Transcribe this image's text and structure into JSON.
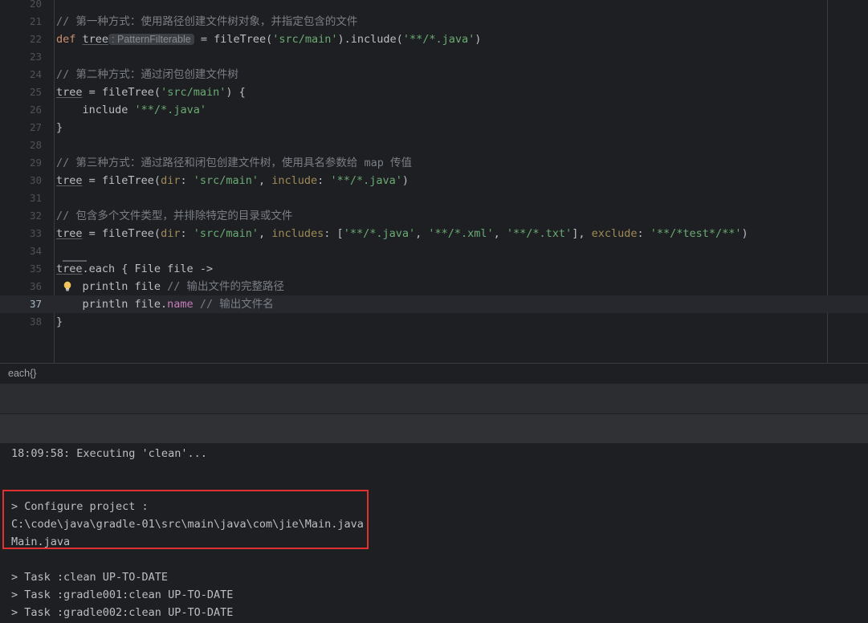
{
  "editor": {
    "name": "code-editor",
    "language": "Groovy",
    "margin_guide_column": 1030,
    "current_line": 37,
    "lines": [
      {
        "no": "20",
        "segments": []
      },
      {
        "no": "21",
        "segments": [
          {
            "t": "cmt",
            "s": "// 第一种方式：使用路径创建文件树对象，并指定包含的文件"
          }
        ]
      },
      {
        "no": "22",
        "segments": [
          {
            "t": "kw",
            "s": "def "
          },
          {
            "t": "ident-u",
            "s": "tree"
          },
          {
            "t": "hint",
            "s": ": PatternFilterable"
          },
          {
            "t": "plain",
            "s": " = fileTree("
          },
          {
            "t": "str",
            "s": "'src/main'"
          },
          {
            "t": "plain",
            "s": ").include("
          },
          {
            "t": "str",
            "s": "'**/*.java'"
          },
          {
            "t": "plain",
            "s": ")"
          }
        ]
      },
      {
        "no": "23",
        "segments": []
      },
      {
        "no": "24",
        "segments": [
          {
            "t": "cmt",
            "s": "// 第二种方式：通过闭包创建文件树"
          }
        ]
      },
      {
        "no": "25",
        "segments": [
          {
            "t": "ident-u",
            "s": "tree"
          },
          {
            "t": "plain",
            "s": " = fileTree("
          },
          {
            "t": "str",
            "s": "'src/main'"
          },
          {
            "t": "plain",
            "s": ") {"
          }
        ]
      },
      {
        "no": "26",
        "segments": [
          {
            "t": "plain",
            "s": "    include "
          },
          {
            "t": "str",
            "s": "'**/*.java'"
          }
        ]
      },
      {
        "no": "27",
        "segments": [
          {
            "t": "plain",
            "s": "}"
          }
        ]
      },
      {
        "no": "28",
        "segments": []
      },
      {
        "no": "29",
        "segments": [
          {
            "t": "cmt",
            "s": "// 第三种方式：通过路径和闭包创建文件树，使用具名参数给 map 传值"
          }
        ]
      },
      {
        "no": "30",
        "segments": [
          {
            "t": "ident-u",
            "s": "tree"
          },
          {
            "t": "plain",
            "s": " = fileTree("
          },
          {
            "t": "narg",
            "s": "dir"
          },
          {
            "t": "plain",
            "s": ": "
          },
          {
            "t": "str",
            "s": "'src/main'"
          },
          {
            "t": "plain",
            "s": ", "
          },
          {
            "t": "narg",
            "s": "include"
          },
          {
            "t": "plain",
            "s": ": "
          },
          {
            "t": "str",
            "s": "'**/*.java'"
          },
          {
            "t": "plain",
            "s": ")"
          }
        ]
      },
      {
        "no": "31",
        "segments": []
      },
      {
        "no": "32",
        "segments": [
          {
            "t": "cmt",
            "s": "// 包含多个文件类型，并排除特定的目录或文件"
          }
        ]
      },
      {
        "no": "33",
        "segments": [
          {
            "t": "ident-u",
            "s": "tree"
          },
          {
            "t": "plain",
            "s": " = fileTree("
          },
          {
            "t": "narg",
            "s": "dir"
          },
          {
            "t": "plain",
            "s": ": "
          },
          {
            "t": "str",
            "s": "'src/main'"
          },
          {
            "t": "plain",
            "s": ", "
          },
          {
            "t": "narg",
            "s": "includes"
          },
          {
            "t": "plain",
            "s": ": ["
          },
          {
            "t": "str",
            "s": "'**/*.java'"
          },
          {
            "t": "plain",
            "s": ", "
          },
          {
            "t": "str",
            "s": "'**/*.xml'"
          },
          {
            "t": "plain",
            "s": ", "
          },
          {
            "t": "str",
            "s": "'**/*.txt'"
          },
          {
            "t": "plain",
            "s": "], "
          },
          {
            "t": "narg",
            "s": "exclude"
          },
          {
            "t": "plain",
            "s": ": "
          },
          {
            "t": "str",
            "s": "'**/*test*/**'"
          },
          {
            "t": "plain",
            "s": ")"
          }
        ]
      },
      {
        "no": "34",
        "segments": []
      },
      {
        "no": "35",
        "segments": [
          {
            "t": "ident-u",
            "s": "tree"
          },
          {
            "t": "plain",
            "s": ".each { File file ->"
          }
        ],
        "fold_bar": true
      },
      {
        "no": "36",
        "segments": [
          {
            "t": "plain",
            "s": "    println file "
          },
          {
            "t": "cmt",
            "s": "// 输出文件的完整路径"
          }
        ],
        "bulb": true
      },
      {
        "no": "37",
        "segments": [
          {
            "t": "plain",
            "s": "    println file."
          },
          {
            "t": "fld",
            "s": "name"
          },
          {
            "t": "plain",
            "s": " "
          },
          {
            "t": "cmt",
            "s": "// 输出文件名"
          }
        ],
        "current": true
      },
      {
        "no": "38",
        "segments": [
          {
            "t": "plain",
            "s": "}"
          }
        ]
      }
    ]
  },
  "breadcrumb": {
    "text": "each{}"
  },
  "console": {
    "name": "gradle-run-console",
    "lines": [
      {
        "text": "18:09:58: Executing 'clean'..."
      },
      {
        "text": ""
      },
      {
        "text": ""
      },
      {
        "text": "> Configure project :"
      },
      {
        "text": "C:\\code\\java\\gradle-01\\src\\main\\java\\com\\jie\\Main.java"
      },
      {
        "text": "Main.java"
      },
      {
        "text": ""
      },
      {
        "text": "> Task :clean UP-TO-DATE"
      },
      {
        "text": "> Task :gradle001:clean UP-TO-DATE"
      },
      {
        "text": "> Task :gradle002:clean UP-TO-DATE"
      }
    ]
  },
  "annotation": {
    "name": "red-highlight-box",
    "color": "#e03030",
    "covers": "> Configure project : / C:\\code\\java\\gradle-01\\src\\main\\java\\com\\jie\\Main.java / Main.java"
  },
  "colors": {
    "editor_bg": "#1e1f22",
    "current_line_bg": "#26282e",
    "panel_bg": "#2b2d30",
    "toolbar_bg": "#2f3134",
    "text": "#bcbec4",
    "comment": "#7a7e85",
    "string": "#6aab73",
    "keyword": "#cf8e6d",
    "named_arg": "#9e8b57",
    "field": "#c77dbb",
    "line_number": "#4e5157",
    "annotation_red": "#e03030",
    "bulb_yellow": "#f2c55c"
  }
}
